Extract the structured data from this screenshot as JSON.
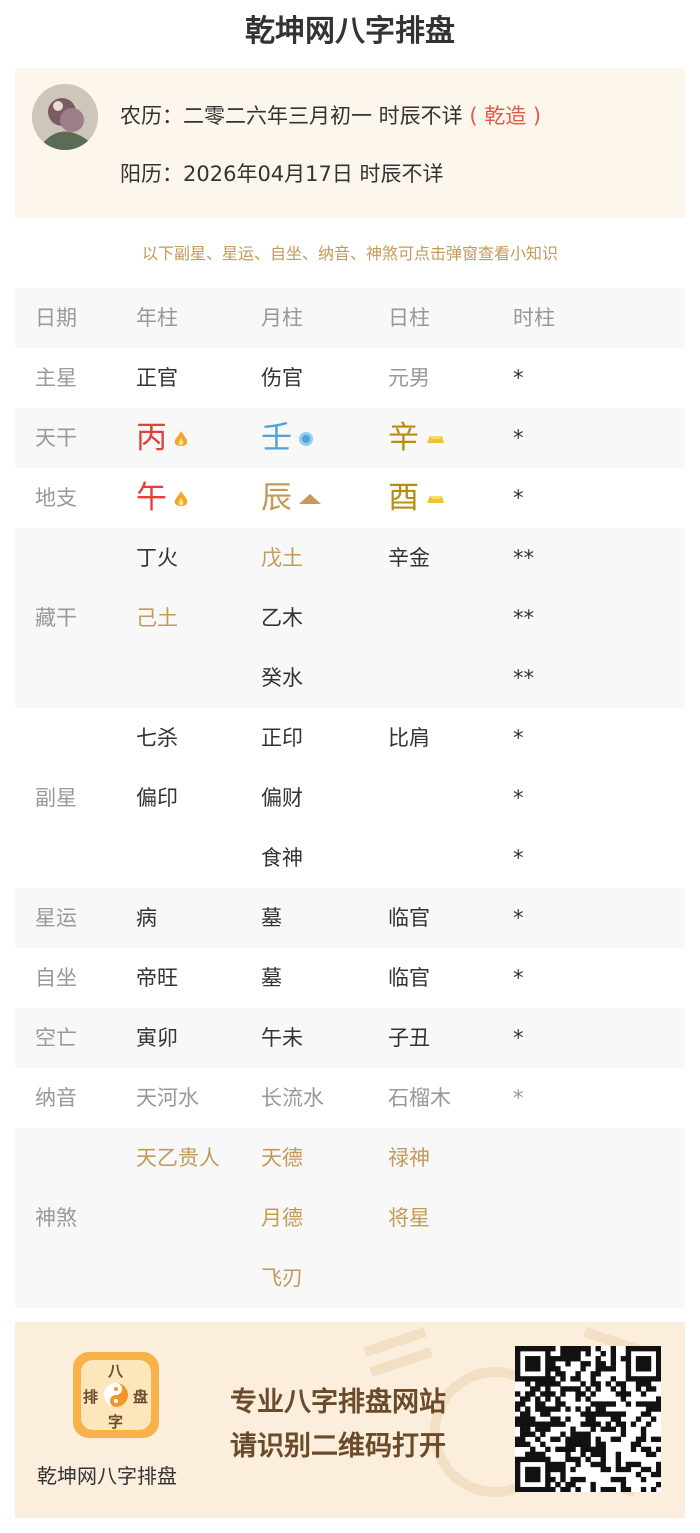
{
  "page_title": "乾坤网八字排盘",
  "profile": {
    "lunar_prefix": "农历：二零二六年三月初一 时辰不详",
    "gender_tag": "( 乾造 )",
    "solar": "阳历：2026年04月17日 时辰不详"
  },
  "hint": "以下副星、星运、自坐、纳音、神煞可点击弹窗查看小知识",
  "table": {
    "header": [
      "日期",
      "年柱",
      "月柱",
      "日柱",
      "时柱"
    ],
    "main_star": {
      "label": "主星",
      "values": [
        "正官",
        "伤官",
        "元男",
        "*"
      ]
    },
    "heavenly_stem": {
      "label": "天干",
      "values": [
        "丙",
        "壬",
        "辛",
        "*"
      ],
      "icons": [
        "fire-icon",
        "water-icon",
        "metal-icon"
      ]
    },
    "earthly_branch": {
      "label": "地支",
      "values": [
        "午",
        "辰",
        "酉",
        "*"
      ],
      "icons": [
        "fire-icon",
        "earth-icon",
        "metal-icon"
      ]
    },
    "hidden_stems": {
      "label": "藏干",
      "year": [
        "丁火",
        "己土"
      ],
      "month": [
        "戊土",
        "乙木",
        "癸水"
      ],
      "day": [
        "辛金"
      ],
      "hour": [
        "**",
        "**",
        "**"
      ]
    },
    "sub_star": {
      "label": "副星",
      "year": [
        "七杀",
        "偏印"
      ],
      "month": [
        "正印",
        "偏财",
        "食神"
      ],
      "day": [
        "比肩"
      ],
      "hour": [
        "*",
        "*",
        "*"
      ]
    },
    "star_luck": {
      "label": "星运",
      "values": [
        "病",
        "墓",
        "临官",
        "*"
      ]
    },
    "self_seat": {
      "label": "自坐",
      "values": [
        "帝旺",
        "墓",
        "临官",
        "*"
      ]
    },
    "void": {
      "label": "空亡",
      "values": [
        "寅卯",
        "午未",
        "子丑",
        "*"
      ]
    },
    "nayin": {
      "label": "纳音",
      "values": [
        "天河水",
        "长流水",
        "石榴木",
        "*"
      ]
    },
    "shensha": {
      "label": "神煞",
      "year": [
        "天乙贵人"
      ],
      "month": [
        "天德",
        "月德",
        "飞刃"
      ],
      "day": [
        "禄神",
        "将星"
      ]
    }
  },
  "footer": {
    "logo_chars": [
      "八",
      "排",
      "盘",
      "字"
    ],
    "brand": "乾坤网八字排盘",
    "slogan1": "专业八字排盘网站",
    "slogan2": "请识别二维码打开"
  },
  "colors": {
    "fire": "#e0423b",
    "water": "#4ea3d8",
    "earth": "#c49a5a",
    "metal": "#b88d12",
    "accent": "#c49a5a",
    "highlight": "#e05a47"
  }
}
